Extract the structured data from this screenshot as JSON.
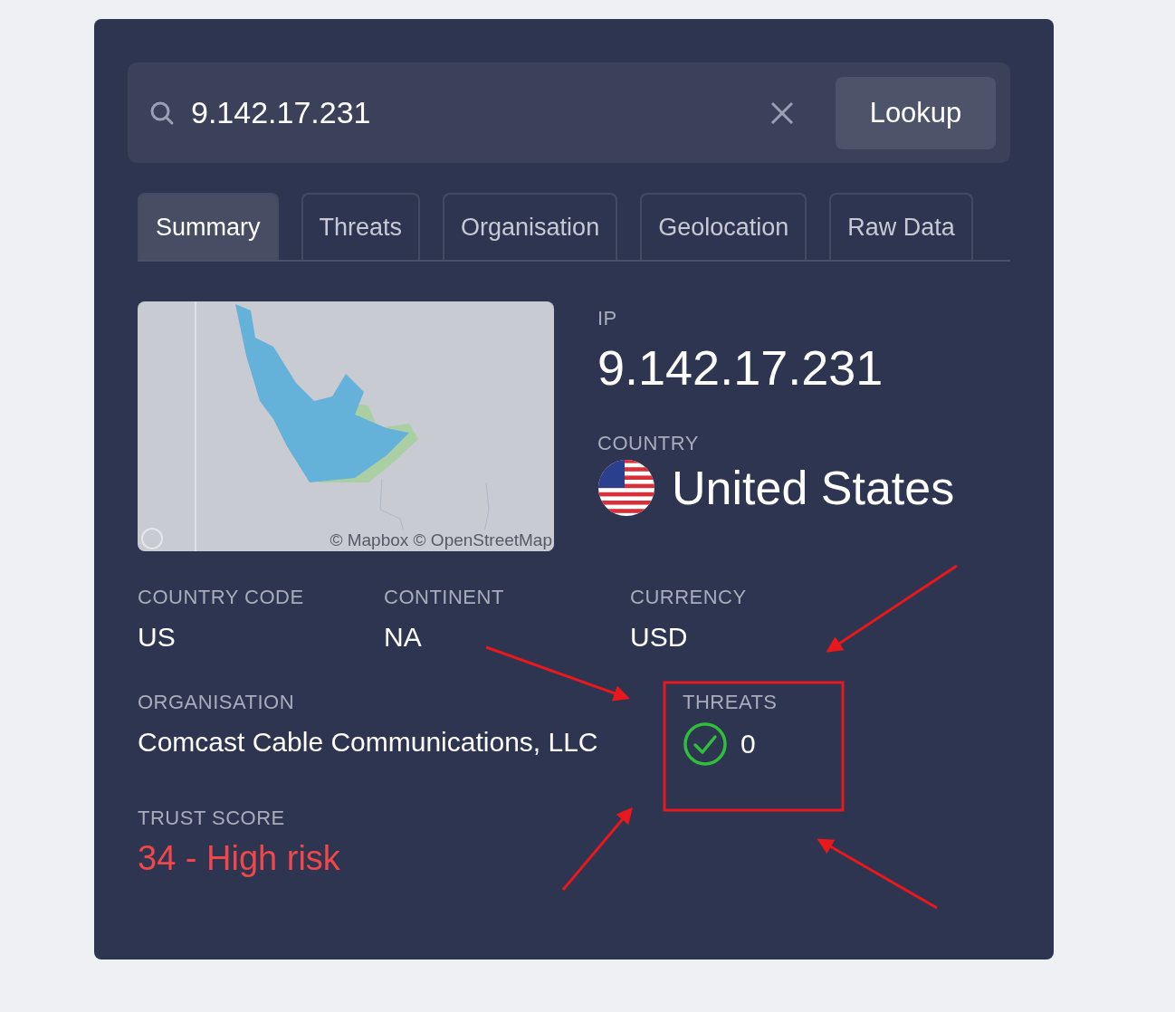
{
  "search": {
    "value": "9.142.17.231"
  },
  "lookup_button": "Lookup",
  "tabs": [
    {
      "label": "Summary",
      "selected": true
    },
    {
      "label": "Threats",
      "selected": false
    },
    {
      "label": "Organisation",
      "selected": false
    },
    {
      "label": "Geolocation",
      "selected": false
    },
    {
      "label": "Raw Data",
      "selected": false
    }
  ],
  "map": {
    "kind": "picture",
    "attribution": "© Mapbox © OpenStreetMap"
  },
  "ip": {
    "label": "IP",
    "value": "9.142.17.231"
  },
  "country": {
    "label": "COUNTRY",
    "value": "United States"
  },
  "fields": [
    {
      "label": "COUNTRY CODE",
      "value": "US"
    },
    {
      "label": "CONTINENT",
      "value": "NA"
    },
    {
      "label": "CURRENCY",
      "value": "USD"
    }
  ],
  "organisation": {
    "label": "ORGANISATION",
    "value": "Comcast Cable Communications, LLC"
  },
  "threats": {
    "label": "THREATS",
    "value": "0",
    "kind": "clean"
  },
  "trust_score": {
    "label": "TRUST SCORE",
    "value": "34 - High risk"
  }
}
